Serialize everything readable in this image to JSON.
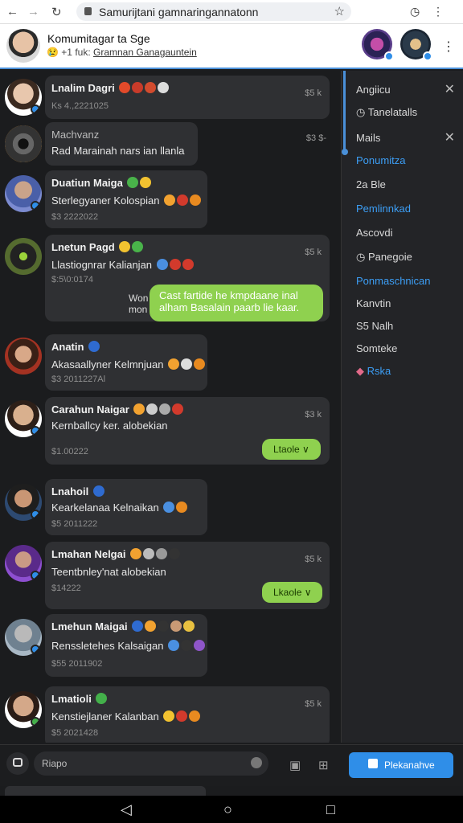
{
  "browser": {
    "url": "Samurijtani gamnaringannatonn"
  },
  "header": {
    "title": "Komumitagar ta Sge",
    "subtitle_prefix": "+1 fuk:",
    "subtitle_link": "Gramnan Ganagauntein"
  },
  "messages": [
    {
      "name": "Lnalim Dagri",
      "text": "",
      "meta": "Ks 4.,2221025",
      "stamp": "$5 k"
    },
    {
      "name": "Machvanz",
      "text": "Rad Marainah nars ian llanla",
      "meta": "",
      "stamp": "$3 $-"
    },
    {
      "name": "Duatiun Maiga",
      "text": "Sterlegyaner Kolospian",
      "meta": "$3 2222022",
      "stamp": ""
    },
    {
      "name": "Lnetun Pagd",
      "text": "Llastiognrar Kalianjan",
      "meta": "$:5\\0:0174",
      "stamp": "$5 k"
    },
    {
      "name": "Anatin",
      "text": "Akasaallyner Kelmnjuan",
      "meta": "$3 2011227Al",
      "stamp": ""
    },
    {
      "name": "Carahun Naigar",
      "text": "Kernballcy ker. alobekian",
      "meta": "$1.00222",
      "stamp": "$3 k"
    },
    {
      "name": "Lnahoil",
      "text": "Kearkelanaa Kelnaikan",
      "meta": "$5 2011222",
      "stamp": ""
    },
    {
      "name": "Lmahan Nelgai",
      "text": "Teentbnley'nat alobekian",
      "meta": "$14222",
      "stamp": "$5 k"
    },
    {
      "name": "Lmehun Maigai",
      "text": "Renssletehes Kalsaigan",
      "meta": "$55 2011902",
      "stamp": ""
    },
    {
      "name": "Lmatioli",
      "text": "Kenstiejlaner Kalanban",
      "meta": "$5 2021428",
      "stamp": "$5 k"
    }
  ],
  "mini_label": "Won\nmon",
  "green_bubble": "Cast fartide he kmpdaane inal alham Basalain paarb lie kaar.",
  "reply_buttons": [
    "Ltaole ∨",
    "Lkaole ∨"
  ],
  "sidebar": {
    "items": [
      "Angiicu",
      "Tanelatalls",
      "Mails",
      "Ponumitza",
      "2a Ble",
      "Pemlinnkad",
      "Ascovdi",
      "Panegoie",
      "Ponmaschnican",
      "Kanvtin",
      "S5 Nalh",
      "Somteke",
      "Rska"
    ]
  },
  "composer": {
    "placeholder": "Riapo",
    "send_label": "Plekanahve"
  }
}
